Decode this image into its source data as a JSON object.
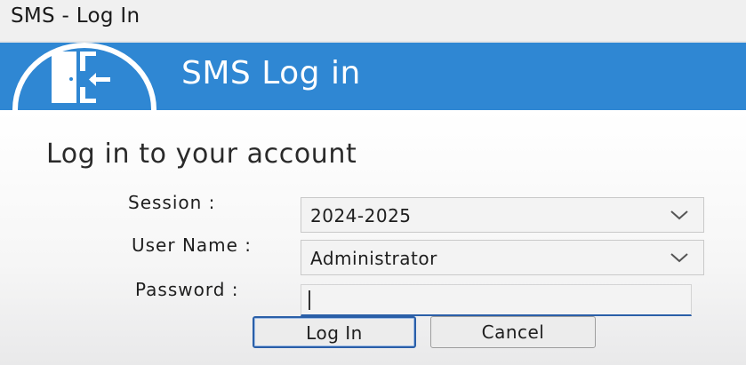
{
  "window": {
    "title": "SMS - Log In"
  },
  "banner": {
    "title": "SMS Log in",
    "icon": "exit-door-icon",
    "color": "#2f87d3"
  },
  "form": {
    "heading": "Log in to your account",
    "session": {
      "label": "Session :",
      "value": "2024-2025"
    },
    "username": {
      "label": "User Name :",
      "value": "Administrator"
    },
    "password": {
      "label": "Password :",
      "value": ""
    }
  },
  "buttons": {
    "login": "Log In",
    "cancel": "Cancel"
  }
}
